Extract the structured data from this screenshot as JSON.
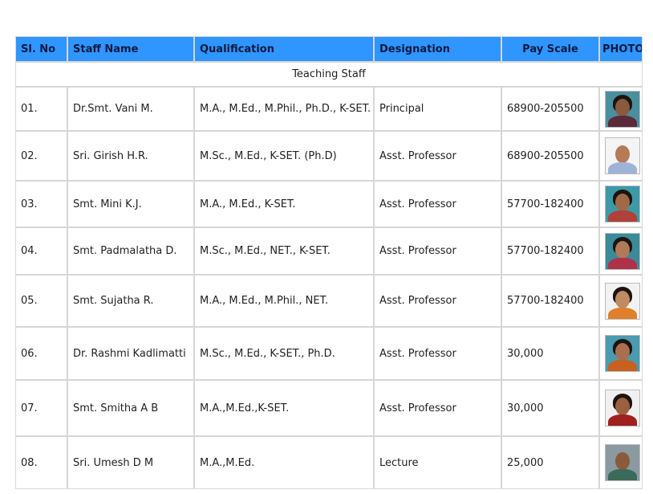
{
  "headers": {
    "sl_no": "Sl. No",
    "staff_name": "Staff Name",
    "qualification": "Qualification",
    "designation": "Designation",
    "pay_scale": "Pay Scale",
    "photo": "PHOTO"
  },
  "section_title": "Teaching Staff",
  "rows": [
    {
      "no": "01.",
      "name": "Dr.Smt. Vani M.",
      "qualification": "M.A., M.Ed., M.Phil., Ph.D., K-SET.",
      "designation": "Principal",
      "pay": "68900-205500",
      "photo": {
        "bg": "#4a8fa0",
        "skin": "#8a5a3c",
        "cloth": "#5a2a3a",
        "hair": true
      }
    },
    {
      "no": "02.",
      "name": "Sri. Girish H.R.",
      "qualification": "M.Sc., M.Ed., K-SET. (Ph.D)",
      "designation": "Asst. Professor",
      "pay": "68900-205500",
      "photo": {
        "bg": "#f4f4f4",
        "skin": "#b57b55",
        "cloth": "#9fb3d8",
        "hair": false
      }
    },
    {
      "no": "03.",
      "name": "Smt. Mini K.J.",
      "qualification": "M.A., M.Ed., K-SET.",
      "designation": "Asst. Professor",
      "pay": "57700-182400",
      "photo": {
        "bg": "#3c9aa8",
        "skin": "#a06a48",
        "cloth": "#b0403a",
        "hair": true
      }
    },
    {
      "no": "04.",
      "name": "Smt. Padmalatha D.",
      "qualification": "M.Sc., M.Ed., NET., K-SET.",
      "designation": "Asst. Professor",
      "pay": "57700-182400",
      "photo": {
        "bg": "#3a8a9a",
        "skin": "#b07a58",
        "cloth": "#b03048",
        "hair": true
      }
    },
    {
      "no": "05.",
      "name": "Smt. Sujatha R.",
      "qualification": "M.A., M.Ed., M.Phil., NET.",
      "designation": "Asst. Professor",
      "pay": "57700-182400",
      "photo": {
        "bg": "#f2f2f2",
        "skin": "#c08a62",
        "cloth": "#e0802a",
        "hair": true
      }
    },
    {
      "no": "06.",
      "name": "Dr. Rashmi Kadlimatti",
      "qualification": "M.Sc., M.Ed., K-SET., Ph.D.",
      "designation": "Asst. Professor",
      "pay": "30,000",
      "photo": {
        "bg": "#4a9ab0",
        "skin": "#a87050",
        "cloth": "#c86020",
        "hair": true
      }
    },
    {
      "no": "07.",
      "name": "Smt. Smitha A B",
      "qualification": "M.A.,M.Ed.,K-SET.",
      "designation": "Asst. Professor",
      "pay": "30,000",
      "photo": {
        "bg": "#f0f0f0",
        "skin": "#9a6040",
        "cloth": "#a02020",
        "hair": true
      }
    },
    {
      "no": "08.",
      "name": "Sri. Umesh D M",
      "qualification": "M.A.,M.Ed.",
      "designation": "Lecture",
      "pay": "25,000",
      "photo": {
        "bg": "#8a9aa0",
        "skin": "#8a5a3a",
        "cloth": "#3a6a5a",
        "hair": false
      }
    }
  ]
}
